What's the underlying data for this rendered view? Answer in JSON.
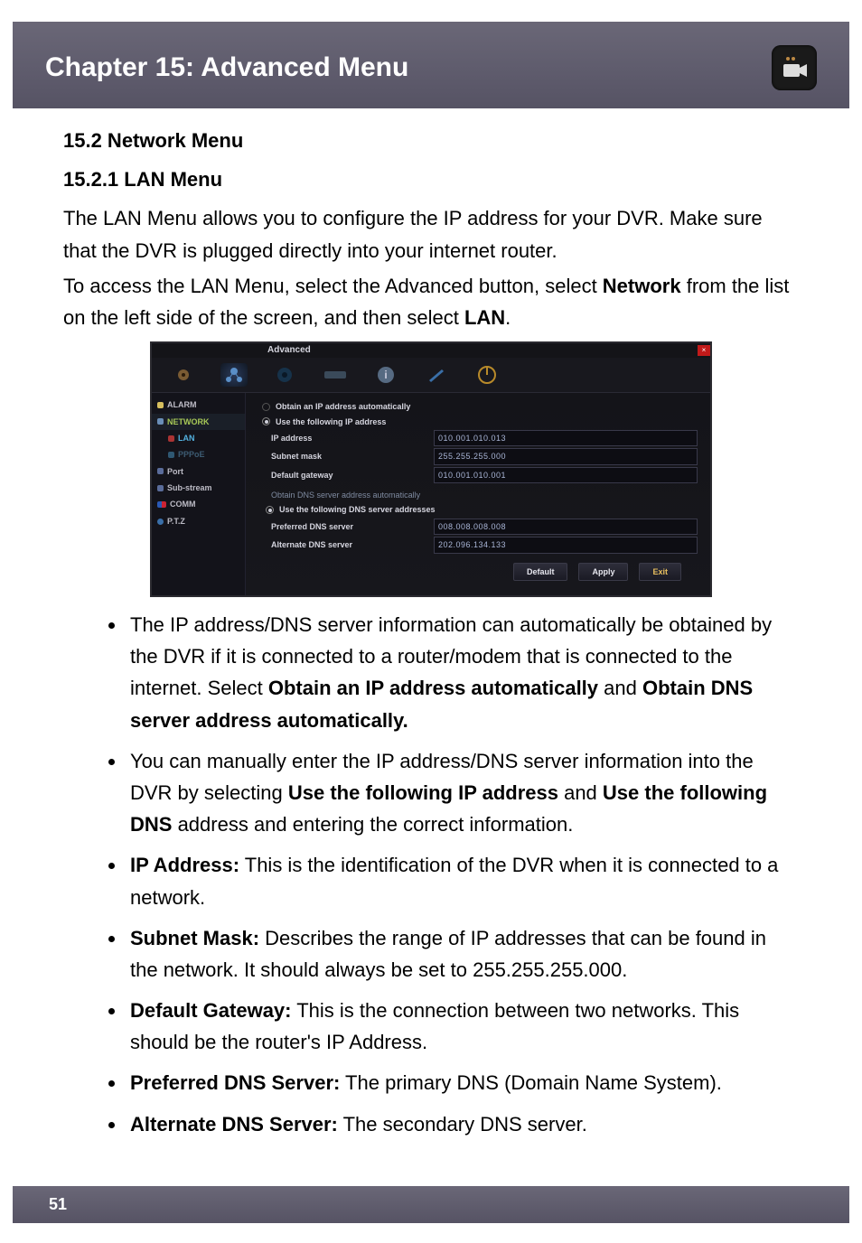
{
  "header": {
    "title": "Chapter 15: Advanced Menu"
  },
  "footer": {
    "page_number": "51"
  },
  "section": {
    "h2": "15.2 Network Menu",
    "h3": "15.2.1 LAN Menu",
    "para1": "The LAN Menu allows you to configure the IP address for your DVR. Make sure that the DVR is plugged directly into your internet router.",
    "para2_a": "To access the LAN Menu, select the Advanced button, select ",
    "para2_b": "Network",
    "para2_c": " from the list on the left side of the screen, and then select ",
    "para2_d": "LAN",
    "para2_e": "."
  },
  "bullets": [
    {
      "pre": "The IP address/DNS server information can automatically be obtained by the DVR if it is connected to a router/modem that is connected to the internet. Select ",
      "b1": "Obtain an IP address automatically",
      "mid": " and ",
      "b2": "Obtain DNS server address automatically."
    },
    {
      "pre": "You can manually enter the IP address/DNS server information into the DVR by selecting ",
      "b1": "Use the following IP address",
      "mid": " and ",
      "b2": "Use the following DNS",
      "post": " address and entering the correct information."
    },
    {
      "b1": "IP Address:",
      "post": " This is the identification of the DVR when it is connected to a network."
    },
    {
      "b1": "Subnet Mask:",
      "post": " Describes the range of IP addresses that can be found in the network. It should always be set to 255.255.255.000."
    },
    {
      "b1": "Default Gateway:",
      "post": " This is the connection between two networks. This should be the router's IP Address."
    },
    {
      "b1": "Preferred DNS Server:",
      "post": " The primary DNS (Domain Name System)."
    },
    {
      "b1": "Alternate DNS Server:",
      "post": " The secondary DNS server."
    }
  ],
  "dvr": {
    "window_title": "Advanced",
    "side": {
      "alarm": "ALARM",
      "network": "NETWORK",
      "lan": "LAN",
      "pppoe": "PPPoE",
      "port": "Port",
      "sub": "Sub-stream",
      "comm": "COMM",
      "ptz": "P.T.Z"
    },
    "radios": {
      "ip_auto": "Obtain an IP address automatically",
      "ip_manual": "Use the following IP address",
      "dns_auto": "Obtain DNS server address automatically",
      "dns_manual": "Use the following DNS server addresses"
    },
    "fields": {
      "ip_label": "IP address",
      "ip_val": "010.001.010.013",
      "mask_label": "Subnet mask",
      "mask_val": "255.255.255.000",
      "gw_label": "Default gateway",
      "gw_val": "010.001.010.001",
      "pdns_label": "Preferred DNS server",
      "pdns_val": "008.008.008.008",
      "adns_label": "Alternate DNS server",
      "adns_val": "202.096.134.133"
    },
    "buttons": {
      "default": "Default",
      "apply": "Apply",
      "exit": "Exit"
    }
  }
}
